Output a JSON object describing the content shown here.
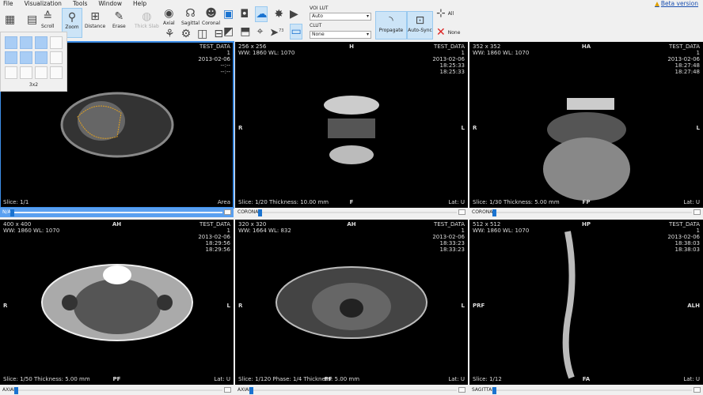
{
  "menu": [
    "File",
    "Visualization",
    "Tools",
    "Window",
    "Help"
  ],
  "beta": "Beta version",
  "toolbar": {
    "scroll": "Scroll",
    "zoom": "Zoom",
    "distance": "Distance",
    "erase": "Erase",
    "thick_slab": "Thick Slab",
    "axial": "Axial",
    "sagittal": "Sagittal",
    "coronal": "Coronal",
    "voi_lut_label": "VOI LUT",
    "voi_lut_value": "Auto",
    "clut_label": "CLUT",
    "clut_value": "None",
    "propagate": "Propagate",
    "auto_sync": "Auto-Sync",
    "all": "All",
    "none": "None",
    "counter": "73"
  },
  "layout_popup": {
    "label": "3x2"
  },
  "viewports": [
    {
      "size": "",
      "wwwl": "",
      "top": "",
      "left": "",
      "right": "",
      "bottom": "",
      "patient": "TEST_DATA",
      "series": "1",
      "date": "2013-02-06",
      "t1": "--:--",
      "t2": "--:--",
      "slice": "Slice: 1/1",
      "lat": "Area",
      "slider": "N/A"
    },
    {
      "size": "256 x 256",
      "wwwl": "WW: 1860 WL: 1070",
      "top": "H",
      "left": "R",
      "right": "L",
      "bottom": "F",
      "patient": "TEST_DATA",
      "series": "1",
      "date": "2013-02-06",
      "t1": "18:25:33",
      "t2": "18:25:33",
      "slice": "Slice: 1/20 Thickness: 10.00 mm",
      "lat": "Lat: U",
      "slider": "CORONAL"
    },
    {
      "size": "352 x 352",
      "wwwl": "WW: 1860 WL: 1070",
      "top": "HA",
      "left": "R",
      "right": "L",
      "bottom": "FP",
      "patient": "TEST_DATA",
      "series": "1",
      "date": "2013-02-06",
      "t1": "18:27:48",
      "t2": "18:27:48",
      "slice": "Slice: 1/30 Thickness: 5.00 mm",
      "lat": "Lat: U",
      "slider": "CORONAL"
    },
    {
      "size": "400 x 400",
      "wwwl": "WW: 1860 WL: 1070",
      "top": "AH",
      "left": "R",
      "right": "L",
      "bottom": "PF",
      "patient": "TEST_DATA",
      "series": "1",
      "date": "2013-02-06",
      "t1": "18:29:56",
      "t2": "18:29:56",
      "slice": "Slice: 1/50 Thickness: 5.00 mm",
      "lat": "Lat: U",
      "slider": "AXIAL"
    },
    {
      "size": "320 x 320",
      "wwwl": "WW: 1664 WL: 832",
      "top": "AH",
      "left": "R",
      "right": "L",
      "bottom": "PF",
      "patient": "TEST_DATA",
      "series": "1",
      "date": "2013-02-06",
      "t1": "18:33:23",
      "t2": "18:33:23",
      "slice": "Slice: 1/120 Phase: 1/4 Thickness: 5.00 mm",
      "lat": "Lat: U",
      "slider": "AXIAL"
    },
    {
      "size": "512 x 512",
      "wwwl": "WW: 1860 WL: 1070",
      "top": "HP",
      "left": "PRF",
      "right": "ALH",
      "bottom": "FA",
      "patient": "TEST_DATA",
      "series": "1",
      "date": "2013-02-06",
      "t1": "18:38:03",
      "t2": "18:38:03",
      "slice": "Slice: 1/12",
      "lat": "Lat: U",
      "slider": "SAGITTAL"
    }
  ]
}
